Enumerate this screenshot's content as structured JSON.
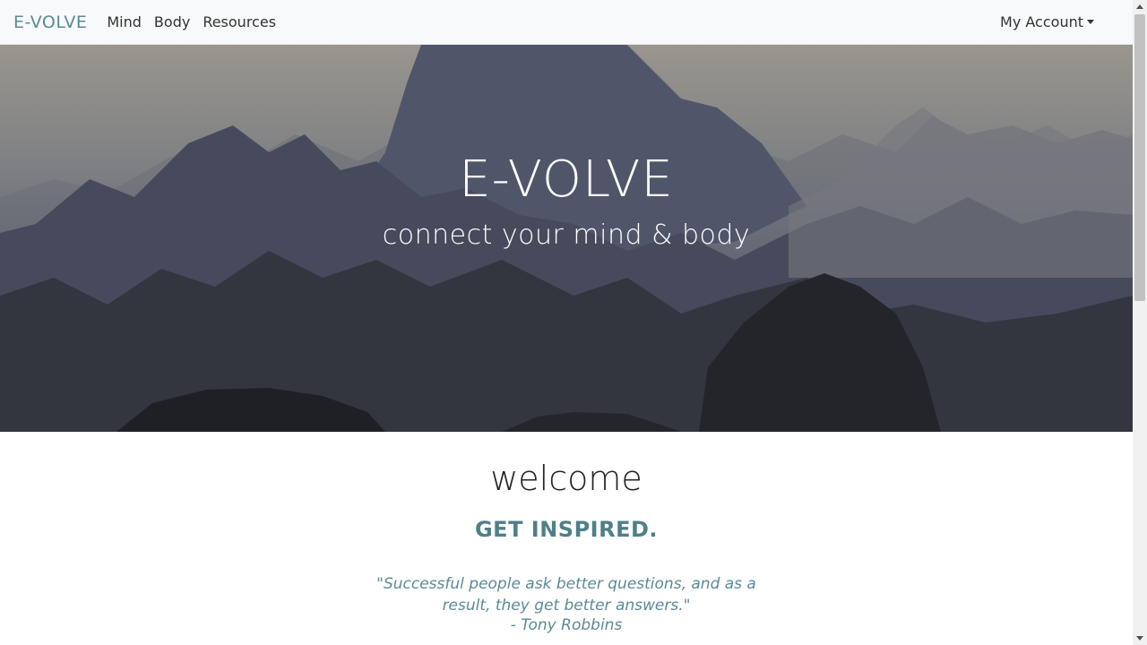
{
  "navbar": {
    "brand": "E-VOLVE",
    "links": [
      "Mind",
      "Body",
      "Resources"
    ],
    "account": "My Account"
  },
  "hero": {
    "title": "E-VOLVE",
    "subtitle": "connect your mind & body"
  },
  "content": {
    "heading": "welcome",
    "subheading": "GET INSPIRED.",
    "quote": "\"Successful people ask better questions, and as a result, they get better answers.\"",
    "author": "- Tony Robbins"
  },
  "colors": {
    "brand": "#5b8a96",
    "accent": "#4f7f87"
  }
}
